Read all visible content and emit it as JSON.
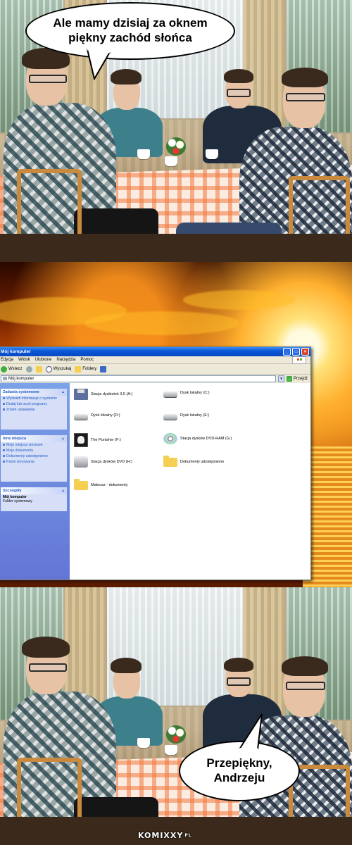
{
  "top_bubble": {
    "line1": "Ale mamy dzisiaj za oknem",
    "line2": "piękny zachód słońca"
  },
  "bottom_bubble": {
    "line1": "Przepiękny,",
    "line2": "Andrzeju"
  },
  "explorer": {
    "title": "Mój komputer",
    "menu": [
      "Edycja",
      "Widok",
      "Ulubione",
      "Narzędzia",
      "Pomoc"
    ],
    "toolbar": {
      "back": "Wstecz",
      "search": "Wyszukaj",
      "folders": "Foldery"
    },
    "address": {
      "value": "Mój komputer",
      "go": "Przejdź"
    },
    "panes": {
      "system": {
        "title": "Zadania systemowe",
        "items": [
          "Wyświetl informacje o systemie",
          "Dodaj lub usuń programy",
          "Zmień ustawienie"
        ]
      },
      "places": {
        "title": "Inne miejsca",
        "items": [
          "Moje miejsca sieciowe",
          "Moje dokumenty",
          "Dokumenty udostępnione",
          "Panel sterowania"
        ]
      },
      "details": {
        "title": "Szczegóły",
        "name": "Mój komputer",
        "type": "Folder systemowy"
      }
    },
    "items": [
      {
        "label": "Stacja dyskietek 3,5 (A:)",
        "icon": "floppy-drive-icon"
      },
      {
        "label": "Dysk lokalny (C:)",
        "icon": "hard-drive-icon"
      },
      {
        "label": "Dysk lokalny (D:)",
        "icon": "hard-drive-icon"
      },
      {
        "label": "Dysk lokalny (E:)",
        "icon": "hard-drive-icon"
      },
      {
        "label": "The Punisher (F:)",
        "icon": "punisher-drive-icon"
      },
      {
        "label": "Stacja dysków DVD-RAM (G:)",
        "icon": "dvd-ram-drive-icon"
      },
      {
        "label": "Stacja dysków DVD (H:)",
        "icon": "dvd-drive-icon"
      },
      {
        "label": "Dokumenty udostępnione",
        "icon": "shared-folder-icon"
      },
      {
        "label": "Mateusz - dokumenty",
        "icon": "folder-icon"
      }
    ]
  },
  "watermark": {
    "brand": "KOMIXXY",
    "suffix": "PL"
  },
  "colors": {
    "xp_title_blue": "#0a58d8",
    "link_blue": "#215dc6",
    "sunset_orange": "#e57d10"
  }
}
